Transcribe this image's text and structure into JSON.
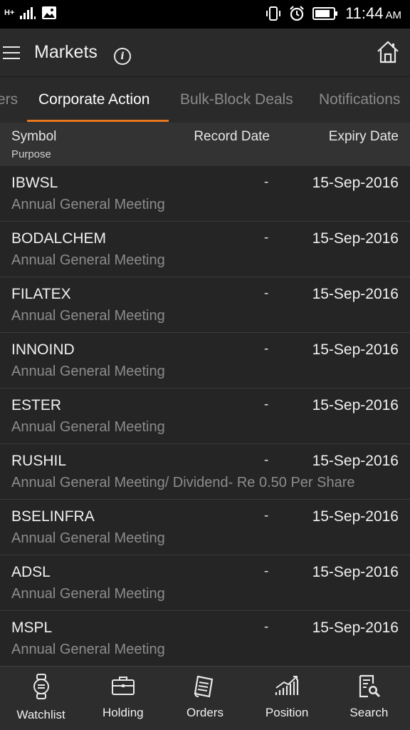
{
  "status_bar": {
    "network": "H+",
    "time": "11:44",
    "ampm": "AM"
  },
  "app_bar": {
    "title": "Markets",
    "info_icon_glyph": "i"
  },
  "tabs": [
    {
      "label": "ers",
      "active": false
    },
    {
      "label": "Corporate Action",
      "active": true
    },
    {
      "label": "Bulk-Block Deals",
      "active": false
    },
    {
      "label": "Notifications",
      "active": false
    }
  ],
  "columns": {
    "symbol": "Symbol",
    "purpose": "Purpose",
    "record_date": "Record Date",
    "expiry_date": "Expiry Date"
  },
  "rows": [
    {
      "symbol": "IBWSL",
      "purpose": "Annual General Meeting",
      "record_date": "-",
      "expiry_date": "15-Sep-2016"
    },
    {
      "symbol": "BODALCHEM",
      "purpose": "Annual General Meeting",
      "record_date": "-",
      "expiry_date": "15-Sep-2016"
    },
    {
      "symbol": "FILATEX",
      "purpose": "Annual General Meeting",
      "record_date": "-",
      "expiry_date": "15-Sep-2016"
    },
    {
      "symbol": "INNOIND",
      "purpose": "Annual General Meeting",
      "record_date": "-",
      "expiry_date": "15-Sep-2016"
    },
    {
      "symbol": "ESTER",
      "purpose": "Annual General Meeting",
      "record_date": "-",
      "expiry_date": "15-Sep-2016"
    },
    {
      "symbol": "RUSHIL",
      "purpose": "Annual General Meeting/ Dividend- Re 0.50 Per Share",
      "record_date": "-",
      "expiry_date": "15-Sep-2016"
    },
    {
      "symbol": "BSELINFRA",
      "purpose": "Annual General Meeting",
      "record_date": "-",
      "expiry_date": "15-Sep-2016"
    },
    {
      "symbol": "ADSL",
      "purpose": "Annual General Meeting",
      "record_date": "-",
      "expiry_date": "15-Sep-2016"
    },
    {
      "symbol": "MSPL",
      "purpose": "Annual General Meeting",
      "record_date": "-",
      "expiry_date": "15-Sep-2016"
    }
  ],
  "bottom_nav": [
    {
      "label": "Watchlist",
      "icon": "watch-icon"
    },
    {
      "label": "Holding",
      "icon": "briefcase-icon"
    },
    {
      "label": "Orders",
      "icon": "orders-icon"
    },
    {
      "label": "Position",
      "icon": "chart-icon"
    },
    {
      "label": "Search",
      "icon": "search-doc-icon"
    }
  ],
  "colors": {
    "accent": "#e87722",
    "background": "#232323",
    "header": "#2a2a2a"
  }
}
